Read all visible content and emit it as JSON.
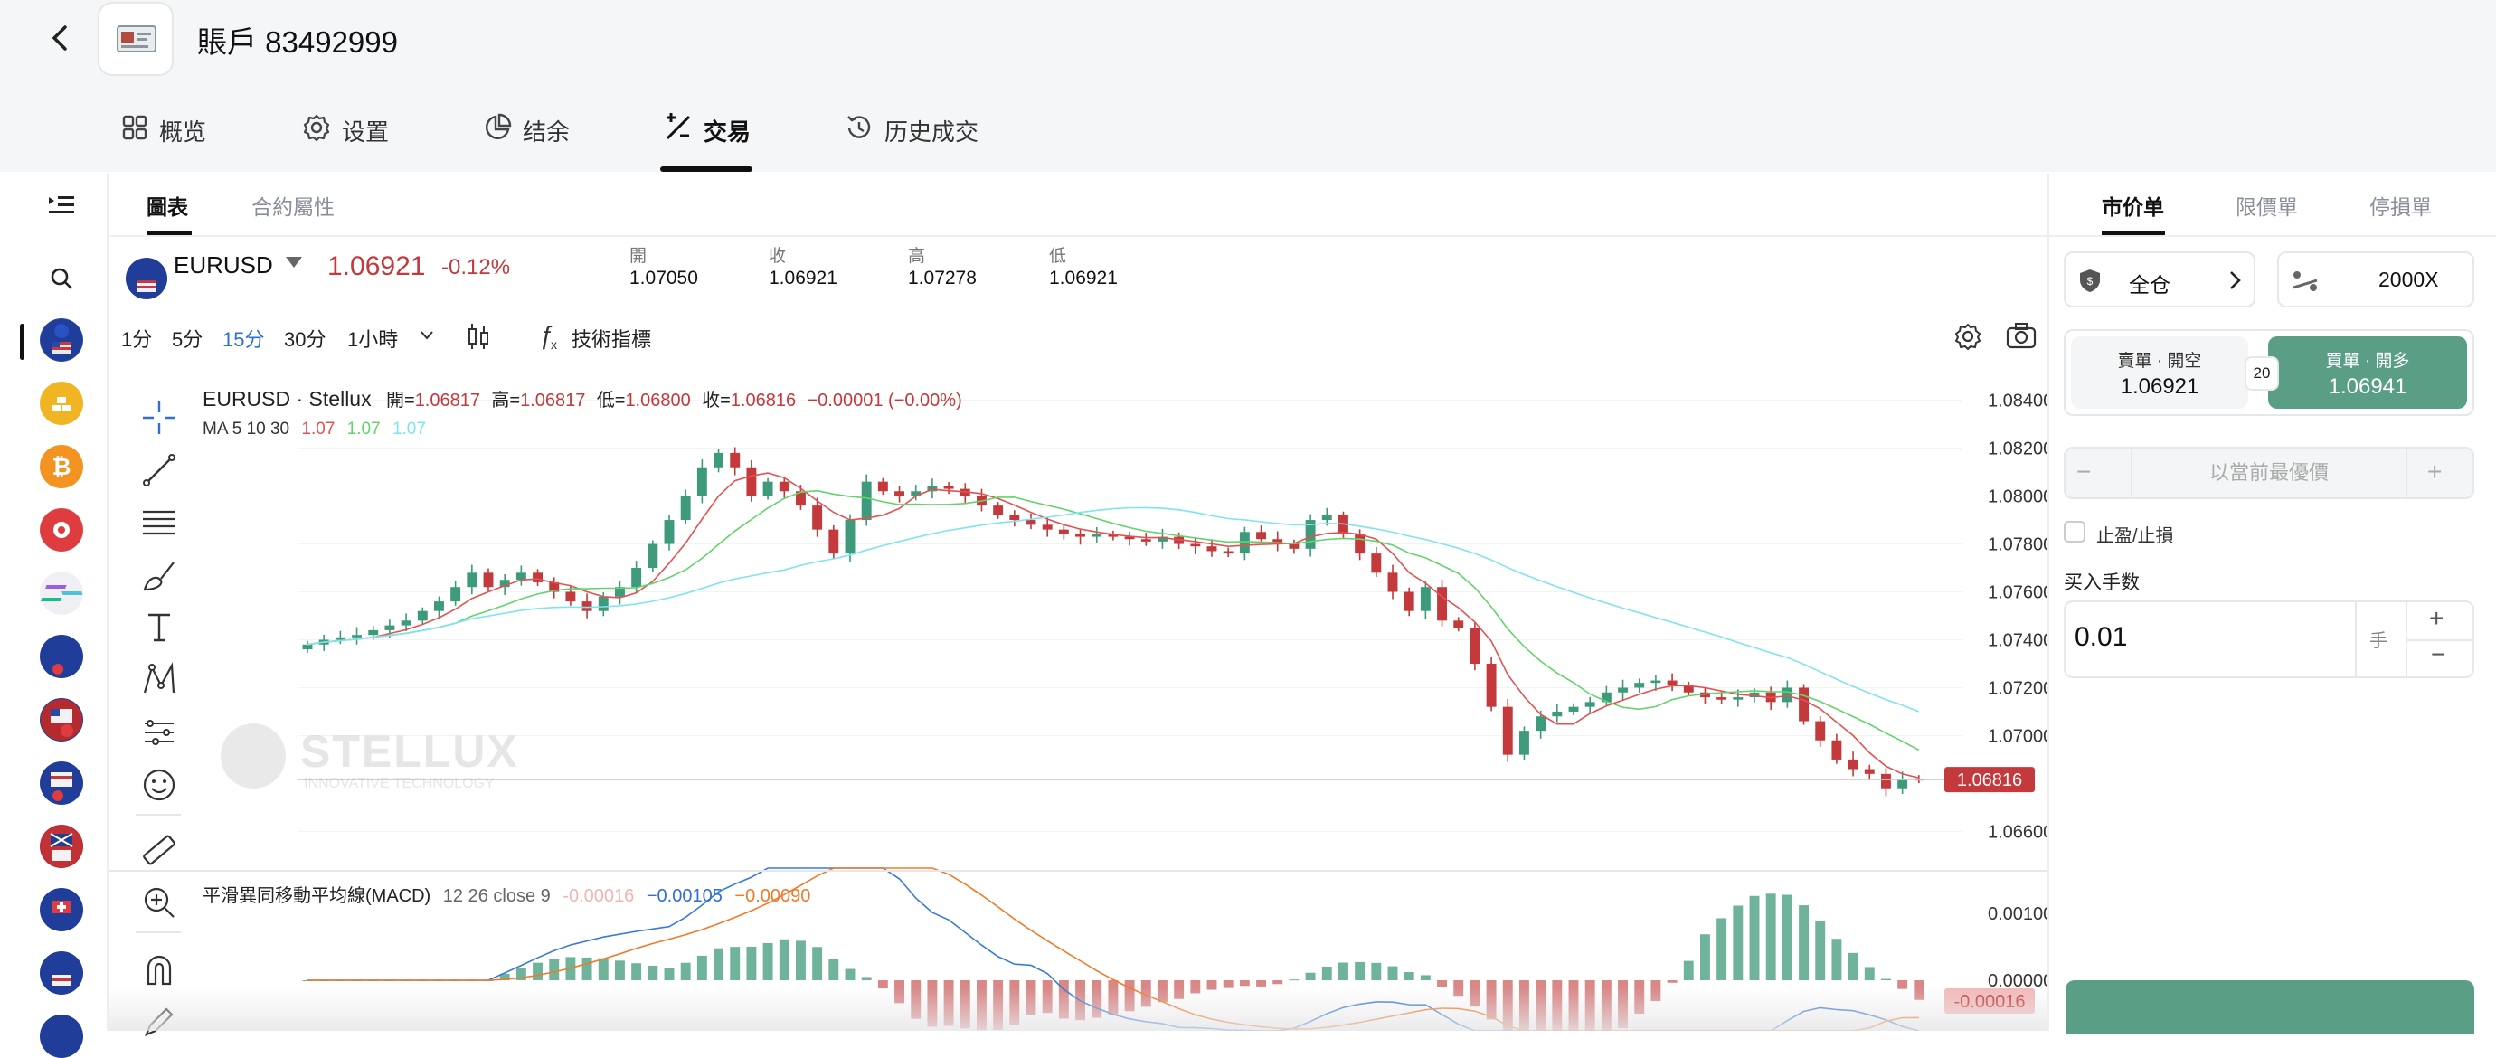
{
  "header": {
    "account_title": "賬戶 83492999"
  },
  "nav": {
    "tabs": [
      {
        "label": "概览",
        "icon": "grid-icon"
      },
      {
        "label": "设置",
        "icon": "gear-icon"
      },
      {
        "label": "结余",
        "icon": "pie-icon"
      },
      {
        "label": "交易",
        "icon": "trade-icon",
        "active": true
      },
      {
        "label": "历史成交",
        "icon": "history-icon"
      }
    ]
  },
  "chart_tabs": {
    "chart": "圖表",
    "contract": "合約屬性"
  },
  "symbol": {
    "name": "EURUSD",
    "price": "1.06921",
    "change": "-0.12%",
    "stats": [
      {
        "label": "開",
        "value": "1.07050"
      },
      {
        "label": "收",
        "value": "1.06921"
      },
      {
        "label": "高",
        "value": "1.07278"
      },
      {
        "label": "低",
        "value": "1.06921"
      }
    ]
  },
  "toolbar": {
    "intervals": [
      "1分",
      "5分",
      "15分",
      "30分",
      "1小時"
    ],
    "active_interval": "15分",
    "indicators": "技術指標"
  },
  "legend": {
    "title": "EURUSD · Stellux",
    "open_label": "開=",
    "open": "1.06817",
    "high_label": "高=",
    "high": "1.06817",
    "low_label": "低=",
    "low": "1.06800",
    "close_label": "收=",
    "close": "1.06816",
    "change": "−0.00001 (−0.00%)",
    "ma_label": "MA 5 10 30",
    "ma5": "1.07",
    "ma10": "1.07",
    "ma30": "1.07"
  },
  "watermark": {
    "brand": "STELLUX",
    "tagline": "INNOVATIVE TECHNOLOGY"
  },
  "macd_legend": {
    "title": "平滑異同移動平均線(MACD)",
    "params": "12 26 close 9",
    "hist": "-0.00016",
    "macd": "−0.00105",
    "signal": "−0.00090"
  },
  "chart_data": {
    "type": "candlestick",
    "price_axis": [
      "1.08400",
      "1.08200",
      "1.08000",
      "1.07800",
      "1.07600",
      "1.07400",
      "1.07200",
      "1.07000",
      "1.06600"
    ],
    "price_ylim": [
      1.0656,
      1.0844
    ],
    "last_price_label": "1.06816",
    "last_price": 1.06816,
    "closes": [
      1.0738,
      1.074,
      1.0741,
      1.0742,
      1.0744,
      1.0746,
      1.0748,
      1.0752,
      1.0756,
      1.0762,
      1.0768,
      1.0762,
      1.0765,
      1.0768,
      1.0764,
      1.076,
      1.0756,
      1.0752,
      1.0758,
      1.0762,
      1.077,
      1.078,
      1.079,
      1.08,
      1.0812,
      1.0818,
      1.0812,
      1.08,
      1.0806,
      1.0802,
      1.0796,
      1.0786,
      1.0776,
      1.079,
      1.0806,
      1.0802,
      1.08,
      1.0802,
      1.0804,
      1.0803,
      1.08,
      1.0796,
      1.0792,
      1.079,
      1.0788,
      1.0786,
      1.0784,
      1.0783,
      1.0784,
      1.0783,
      1.0782,
      1.0781,
      1.0783,
      1.078,
      1.0779,
      1.0777,
      1.0776,
      1.0785,
      1.0782,
      1.078,
      1.0778,
      1.079,
      1.0792,
      1.0784,
      1.0776,
      1.0768,
      1.076,
      1.0752,
      1.0762,
      1.0748,
      1.0745,
      1.073,
      1.0712,
      1.0692,
      1.0702,
      1.0708,
      1.071,
      1.0712,
      1.0714,
      1.0718,
      1.072,
      1.0722,
      1.0723,
      1.0721,
      1.0718,
      1.0716,
      1.0715,
      1.0716,
      1.0718,
      1.0714,
      1.072,
      1.0706,
      1.0698,
      1.069,
      1.0686,
      1.0684,
      1.0678,
      1.0682,
      1.06816
    ],
    "macd_axis": [
      "0.00100",
      "0.00000"
    ],
    "macd_last_label": "-0.00016"
  },
  "order": {
    "tabs": [
      "市价单",
      "限價單",
      "停損單"
    ],
    "margin_mode": "全仓",
    "leverage": "2000X",
    "sell_label": "賣單 · 開空",
    "sell_price": "1.06921",
    "spread": "20",
    "buy_label": "買單 · 開多",
    "buy_price": "1.06941",
    "price_placeholder": "以當前最優價",
    "tpsl": "止盈/止損",
    "lots_label": "买入手数",
    "lots_value": "0.01",
    "lots_unit": "手"
  },
  "colors": {
    "up": "#3d9a7a",
    "down": "#c4393b",
    "accent": "#5b9e86"
  }
}
